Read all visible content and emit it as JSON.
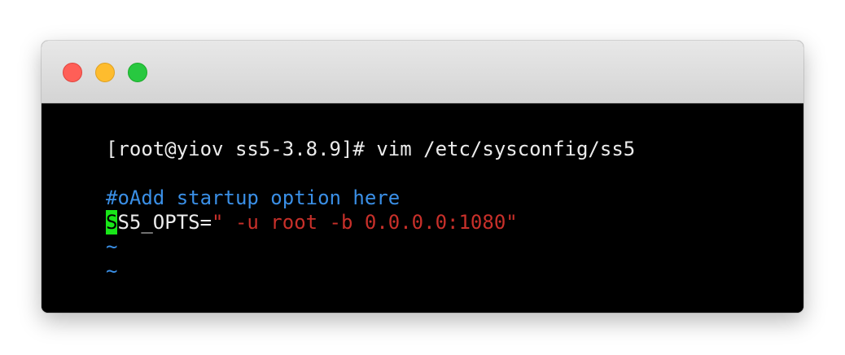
{
  "colors": {
    "close": "#ff5f57",
    "minimize": "#febc2e",
    "zoom": "#28c840",
    "terminal_bg": "#000000",
    "text": "#ececec",
    "comment": "#3a8fe6",
    "string": "#c8302a",
    "tilde": "#3a8fe6",
    "cursor_bg": "#19e619",
    "cursor_fg": "#000000"
  },
  "window": {
    "buttons": [
      {
        "name": "close"
      },
      {
        "name": "minimize"
      },
      {
        "name": "zoom"
      }
    ]
  },
  "terminal": {
    "prompt": "[root@yiov ss5-3.8.9]# vim /etc/sysconfig/ss5",
    "comment": "#oAdd startup option here",
    "cursor_char": "S",
    "assign": "S5_OPTS=",
    "value": "\" -u root -b 0.0.0.0:1080\"",
    "tildes": [
      "~",
      "~"
    ]
  }
}
